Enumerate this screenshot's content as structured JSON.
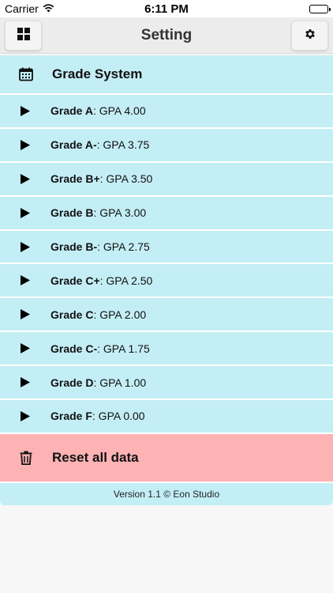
{
  "status_bar": {
    "carrier": "Carrier",
    "time": "6:11 PM"
  },
  "nav": {
    "title": "Setting",
    "left_icon": "grid-icon",
    "right_icon": "gear-icon"
  },
  "grade_system": {
    "title": "Grade System",
    "icon": "calendar-icon",
    "grades": [
      {
        "grade": "Grade A",
        "gpa": ": GPA 4.00"
      },
      {
        "grade": "Grade A-",
        "gpa": ": GPA 3.75"
      },
      {
        "grade": "Grade B+",
        "gpa": ": GPA 3.50"
      },
      {
        "grade": "Grade B",
        "gpa": ": GPA 3.00"
      },
      {
        "grade": "Grade B-",
        "gpa": ": GPA 2.75"
      },
      {
        "grade": "Grade C+",
        "gpa": ": GPA 2.50"
      },
      {
        "grade": "Grade C",
        "gpa": ": GPA 2.00"
      },
      {
        "grade": "Grade C-",
        "gpa": ": GPA 1.75"
      },
      {
        "grade": "Grade D",
        "gpa": ": GPA 1.00"
      },
      {
        "grade": "Grade F",
        "gpa": ": GPA 0.00"
      }
    ]
  },
  "reset": {
    "label": "Reset all data",
    "icon": "trash-icon"
  },
  "footer": {
    "version": "Version 1.1 © Eon Studio"
  },
  "colors": {
    "list_background": "#c4eef6",
    "reset_background": "#fdb2b4",
    "page_background": "#f7f7f7"
  }
}
